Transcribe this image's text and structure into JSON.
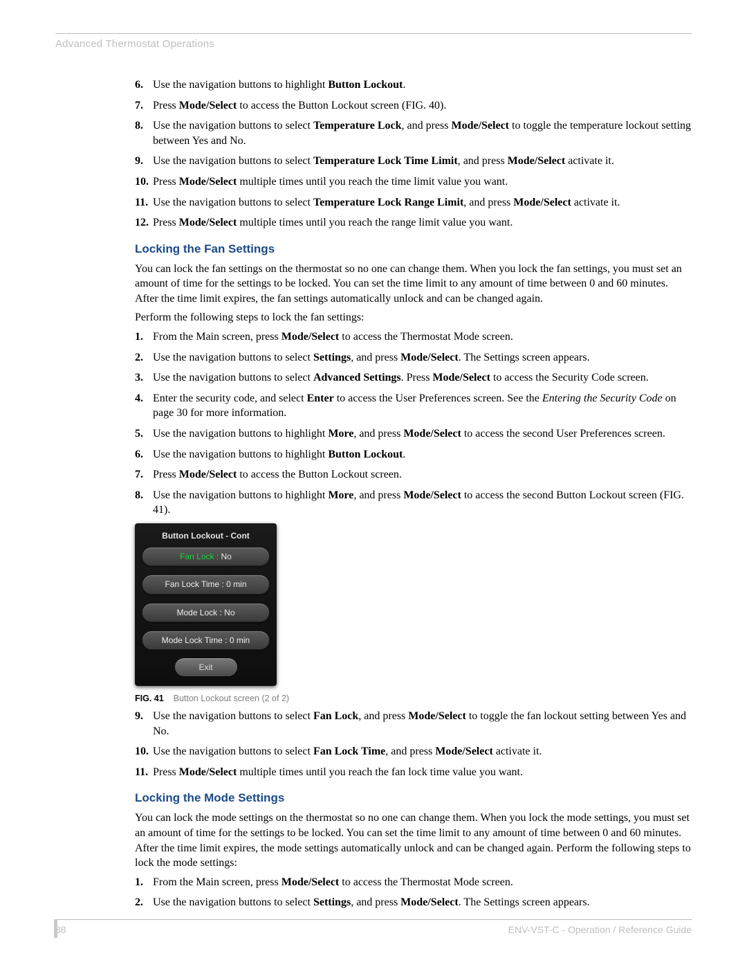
{
  "header": "Advanced Thermostat Operations",
  "steps_top": [
    {
      "n": "6.",
      "parts": [
        {
          "t": "Use the navigation buttons to highlight "
        },
        {
          "b": "Button Lockout"
        },
        {
          "t": "."
        }
      ]
    },
    {
      "n": "7.",
      "parts": [
        {
          "t": "Press "
        },
        {
          "b": "Mode/Select"
        },
        {
          "t": " to access the Button Lockout screen (FIG. 40)."
        }
      ]
    },
    {
      "n": "8.",
      "parts": [
        {
          "t": "Use the navigation buttons to select "
        },
        {
          "b": "Temperature Lock"
        },
        {
          "t": ", and press "
        },
        {
          "b": "Mode/Select"
        },
        {
          "t": " to toggle the temperature lockout setting between Yes and No."
        }
      ]
    },
    {
      "n": "9.",
      "parts": [
        {
          "t": "Use the navigation buttons to select "
        },
        {
          "b": "Temperature Lock Time Limit"
        },
        {
          "t": ", and press "
        },
        {
          "b": "Mode/Select"
        },
        {
          "t": " activate it."
        }
      ]
    },
    {
      "n": "10.",
      "parts": [
        {
          "t": "Press "
        },
        {
          "b": "Mode/Select"
        },
        {
          "t": " multiple times until you reach the time limit value you want."
        }
      ]
    },
    {
      "n": "11.",
      "parts": [
        {
          "t": "Use the navigation buttons to select "
        },
        {
          "b": "Temperature Lock Range Limit"
        },
        {
          "t": ", and press "
        },
        {
          "b": "Mode/Select"
        },
        {
          "t": " activate it."
        }
      ]
    },
    {
      "n": "12.",
      "parts": [
        {
          "t": "Press "
        },
        {
          "b": "Mode/Select"
        },
        {
          "t": " multiple times until you reach the range limit value you want."
        }
      ]
    }
  ],
  "fan_section": {
    "heading": "Locking the Fan Settings",
    "p1": "You can lock the fan settings on the thermostat so no one can change them. When you lock the fan settings, you must set an amount of time for the settings to be locked. You can set the time limit to any amount of time between 0 and 60 minutes. After the time limit expires, the fan settings automatically unlock and can be changed again.",
    "p2": "Perform the following steps to lock the fan settings:",
    "steps": [
      {
        "n": "1.",
        "parts": [
          {
            "t": "From the Main screen, press "
          },
          {
            "b": "Mode/Select"
          },
          {
            "t": " to access the Thermostat Mode screen."
          }
        ]
      },
      {
        "n": "2.",
        "parts": [
          {
            "t": "Use the navigation buttons to select "
          },
          {
            "b": "Settings"
          },
          {
            "t": ", and press "
          },
          {
            "b": "Mode/Select"
          },
          {
            "t": ". The Settings screen appears."
          }
        ]
      },
      {
        "n": "3.",
        "parts": [
          {
            "t": "Use the navigation buttons to select "
          },
          {
            "b": "Advanced Settings"
          },
          {
            "t": ". Press "
          },
          {
            "b": "Mode/Select"
          },
          {
            "t": " to access the Security Code screen."
          }
        ]
      },
      {
        "n": "4.",
        "parts": [
          {
            "t": "Enter the security code, and select "
          },
          {
            "b": "Enter"
          },
          {
            "t": " to access the User Preferences screen. See the "
          },
          {
            "i": "Entering the Security Code"
          },
          {
            "t": " on page 30 for more information."
          }
        ]
      },
      {
        "n": "5.",
        "parts": [
          {
            "t": "Use the navigation buttons to highlight "
          },
          {
            "b": "More"
          },
          {
            "t": ", and press "
          },
          {
            "b": "Mode/Select"
          },
          {
            "t": " to access the second User Preferences screen."
          }
        ]
      },
      {
        "n": "6.",
        "parts": [
          {
            "t": "Use the navigation buttons to highlight "
          },
          {
            "b": "Button Lockout"
          },
          {
            "t": "."
          }
        ]
      },
      {
        "n": "7.",
        "parts": [
          {
            "t": "Press "
          },
          {
            "b": "Mode/Select"
          },
          {
            "t": " to access the Button Lockout screen."
          }
        ]
      },
      {
        "n": "8.",
        "parts": [
          {
            "t": "Use the navigation buttons to highlight "
          },
          {
            "b": "More"
          },
          {
            "t": ", and press "
          },
          {
            "b": "Mode/Select"
          },
          {
            "t": " to access the second Button Lockout screen (FIG. 41)."
          }
        ]
      }
    ],
    "steps_after": [
      {
        "n": "9.",
        "parts": [
          {
            "t": "Use the navigation buttons to select "
          },
          {
            "b": "Fan Lock"
          },
          {
            "t": ", and press "
          },
          {
            "b": "Mode/Select"
          },
          {
            "t": " to toggle the fan lockout setting between Yes and No."
          }
        ]
      },
      {
        "n": "10.",
        "parts": [
          {
            "t": "Use the navigation buttons to select "
          },
          {
            "b": "Fan Lock Time"
          },
          {
            "t": ", and press "
          },
          {
            "b": "Mode/Select"
          },
          {
            "t": " activate it."
          }
        ]
      },
      {
        "n": "11.",
        "parts": [
          {
            "t": "Press "
          },
          {
            "b": "Mode/Select"
          },
          {
            "t": " multiple times until you reach the fan lock time value you want."
          }
        ]
      }
    ]
  },
  "figure": {
    "title": "Button Lockout - Cont",
    "rows": [
      {
        "label": "Fan Lock :",
        "value": "No",
        "hl": true
      },
      {
        "label": "Fan Lock Time :",
        "value": "0 min",
        "hl": false
      },
      {
        "label": "Mode Lock :",
        "value": "No",
        "hl": false
      },
      {
        "label": "Mode Lock Time :",
        "value": "0 min",
        "hl": false
      }
    ],
    "exit": "Exit",
    "caption_label": "FIG. 41",
    "caption_text": "Button Lockout screen (2 of 2)"
  },
  "mode_section": {
    "heading": "Locking the Mode Settings",
    "p1": "You can lock the mode settings on the thermostat so no one can change them. When you lock the mode settings, you must set an amount of time for the settings to be locked. You can set the time limit to any amount of time between 0 and 60 minutes. After the time limit expires, the mode settings automatically unlock and can be changed again. Perform the following steps to lock the mode settings:",
    "steps": [
      {
        "n": "1.",
        "parts": [
          {
            "t": "From the Main screen, press "
          },
          {
            "b": "Mode/Select"
          },
          {
            "t": " to access the Thermostat Mode screen."
          }
        ]
      },
      {
        "n": "2.",
        "parts": [
          {
            "t": "Use the navigation buttons to select "
          },
          {
            "b": "Settings"
          },
          {
            "t": ", and press "
          },
          {
            "b": "Mode/Select"
          },
          {
            "t": ". The Settings screen appears."
          }
        ]
      }
    ]
  },
  "footer": {
    "pagenum": "38",
    "right": "ENV-VST-C - Operation / Reference Guide"
  }
}
